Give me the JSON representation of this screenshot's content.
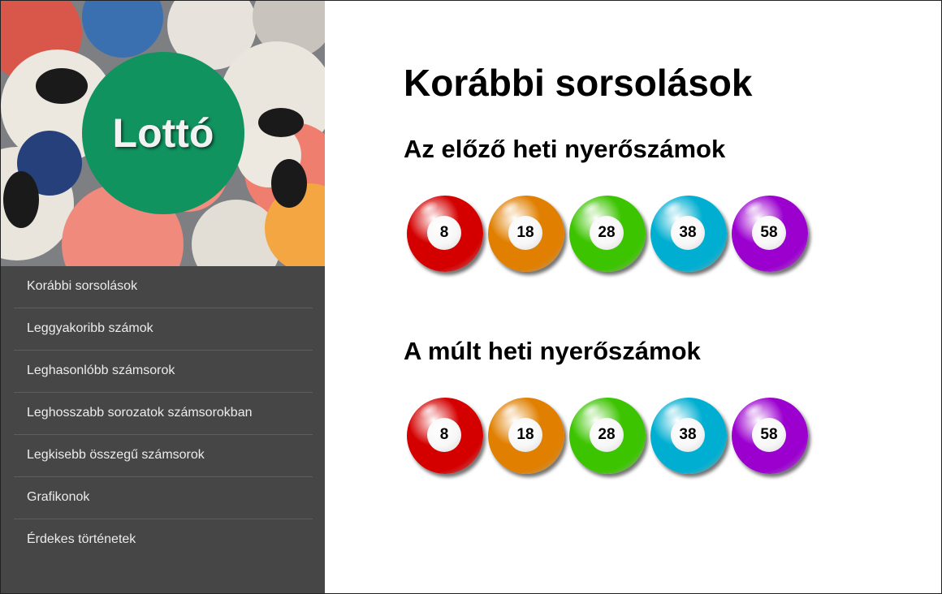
{
  "brand": {
    "logo_text": "Lottó",
    "logo_color": "#10935f"
  },
  "sidebar": {
    "background": "#464646",
    "items": [
      {
        "label": "Korábbi sorsolások"
      },
      {
        "label": "Leggyakoribb számok"
      },
      {
        "label": "Leghasonlóbb számsorok"
      },
      {
        "label": "Leghosszabb sorozatok számsorokban"
      },
      {
        "label": "Legkisebb összegű számsorok"
      },
      {
        "label": "Grafikonok"
      },
      {
        "label": "Érdekes történetek"
      }
    ]
  },
  "main": {
    "title": "Korábbi sorsolások",
    "sections": [
      {
        "title": "Az előző heti nyerőszámok",
        "balls": [
          {
            "number": "8",
            "color": "#d40000",
            "icon": "lottery-ball-red"
          },
          {
            "number": "18",
            "color": "#e07f00",
            "icon": "lottery-ball-orange"
          },
          {
            "number": "28",
            "color": "#3cc400",
            "icon": "lottery-ball-green"
          },
          {
            "number": "38",
            "color": "#00aed1",
            "icon": "lottery-ball-cyan"
          },
          {
            "number": "58",
            "color": "#9b00cf",
            "icon": "lottery-ball-purple"
          }
        ]
      },
      {
        "title": "A múlt heti nyerőszámok",
        "balls": [
          {
            "number": "8",
            "color": "#d40000",
            "icon": "lottery-ball-red"
          },
          {
            "number": "18",
            "color": "#e07f00",
            "icon": "lottery-ball-orange"
          },
          {
            "number": "28",
            "color": "#3cc400",
            "icon": "lottery-ball-green"
          },
          {
            "number": "38",
            "color": "#00aed1",
            "icon": "lottery-ball-cyan"
          },
          {
            "number": "58",
            "color": "#9b00cf",
            "icon": "lottery-ball-purple"
          }
        ]
      }
    ]
  }
}
